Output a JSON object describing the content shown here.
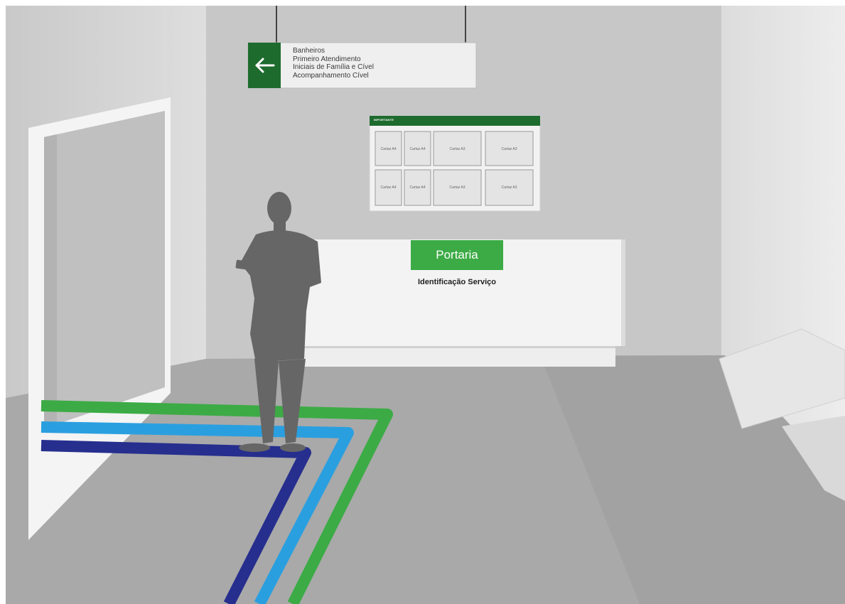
{
  "hanging_sign": {
    "arrow_icon": "arrow-left-icon",
    "lines": [
      "Banheiros",
      "Primeiro Atendimento",
      "Iniciais de Família e Cível",
      "Acompanhamento Cível"
    ]
  },
  "notice_board": {
    "title": "IMPORTANTE",
    "rows": [
      [
        "Cartaz A4",
        "Cartaz A4",
        "Cartaz A3",
        "Cartaz A3"
      ],
      [
        "Cartaz A4",
        "Cartaz A4",
        "Cartaz A3",
        "Cartaz A3"
      ]
    ]
  },
  "reception_desk": {
    "sign_label": "Portaria",
    "service_label": "Identificação Serviço"
  },
  "floor_lines": {
    "colors": [
      "#3cab45",
      "#2a9fe0",
      "#262f8e"
    ]
  },
  "colors": {
    "brand_green": "#1e6b2e",
    "portaria_green": "#3cab45"
  }
}
